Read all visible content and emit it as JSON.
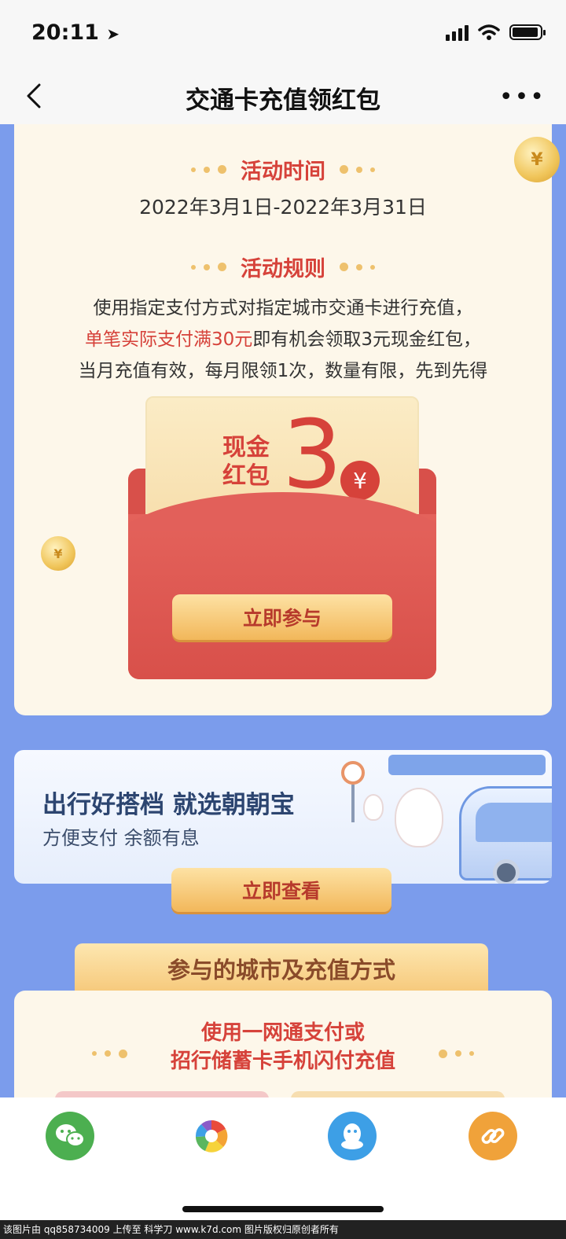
{
  "status": {
    "time": "20:11"
  },
  "nav": {
    "title": "交通卡充值领红包"
  },
  "event": {
    "time_title": "活动时间",
    "date_range": "2022年3月1日-2022年3月31日",
    "rules_title": "活动规则",
    "rule_line1": "使用指定支付方式对指定城市交通卡进行充值，",
    "rule_line2_highlight": "单笔实际支付满30元",
    "rule_line2_rest": "即有机会领取3元现金红包，",
    "rule_line3": "当月充值有效，每月限领1次，数量有限，先到先得"
  },
  "packet": {
    "label": "现金红包",
    "amount": "3",
    "currency": "¥",
    "join_button": "立即参与"
  },
  "banner": {
    "title": "出行好搭档 就选朝朝宝",
    "subtitle": "方便支付 余额有息",
    "view_button": "立即查看"
  },
  "cities": {
    "tab_title": "参与的城市及充值方式",
    "method_line1": "使用一网通支付或",
    "method_line2": "招行储蓄卡手机闪付充值"
  },
  "share": {
    "colors": {
      "wechat": "#4caf50",
      "moments": "#ffffff",
      "qq": "#3d9fe6",
      "link": "#f0a23a"
    }
  },
  "watermark": "该图片由 qq858734009 上传至 科学刀 www.k7d.com 图片版权归原创者所有"
}
